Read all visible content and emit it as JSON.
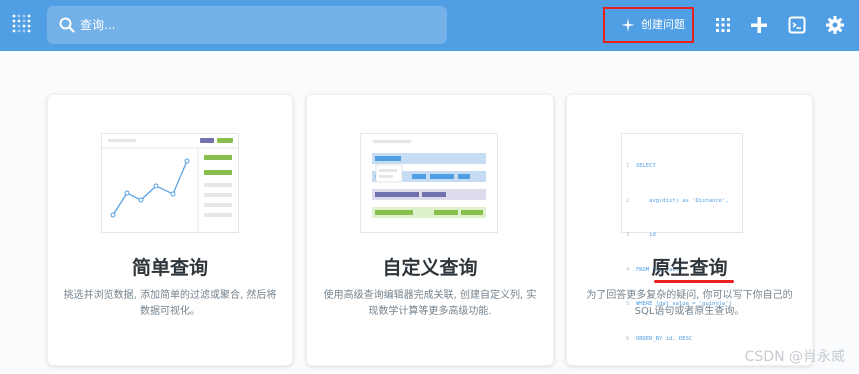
{
  "topbar": {
    "search_placeholder": "查询...",
    "create_label": "创建问题",
    "icons": [
      "logo-icon",
      "search-icon",
      "plus-icon",
      "grid-icon",
      "add-icon",
      "terminal-icon",
      "gear-icon"
    ]
  },
  "cards": [
    {
      "title": "简单查询",
      "desc": "挑选并浏览数据, 添加简单的过滤或聚合, 然后将数据可视化。"
    },
    {
      "title": "自定义查询",
      "desc": "使用高级查询编辑器完成关联, 创建自定义列, 实现数学计算等更多高级功能."
    },
    {
      "title": "原生查询",
      "desc": "为了回答更多复杂的疑问, 你可以写下你自己的SQL语句或者原生查询。"
    }
  ],
  "sql_lines": [
    {
      "num": "1",
      "text": "SELECT"
    },
    {
      "num": "2",
      "text": "    avg(dist) as 'Distance',"
    },
    {
      "num": "3",
      "text": "    id"
    },
    {
      "num": "4",
      "text": "FROM dat_table"
    },
    {
      "num": "5",
      "text": "WHERE (dat_value = 'quinnle')"
    },
    {
      "num": "6",
      "text": "ORDER_BY id, DESC"
    }
  ],
  "watermark": "CSDN @肖永威",
  "colors": {
    "brand": "#509ee3",
    "highlight": "#e8211f",
    "green": "#88bf4d",
    "purple": "#7172ad"
  }
}
